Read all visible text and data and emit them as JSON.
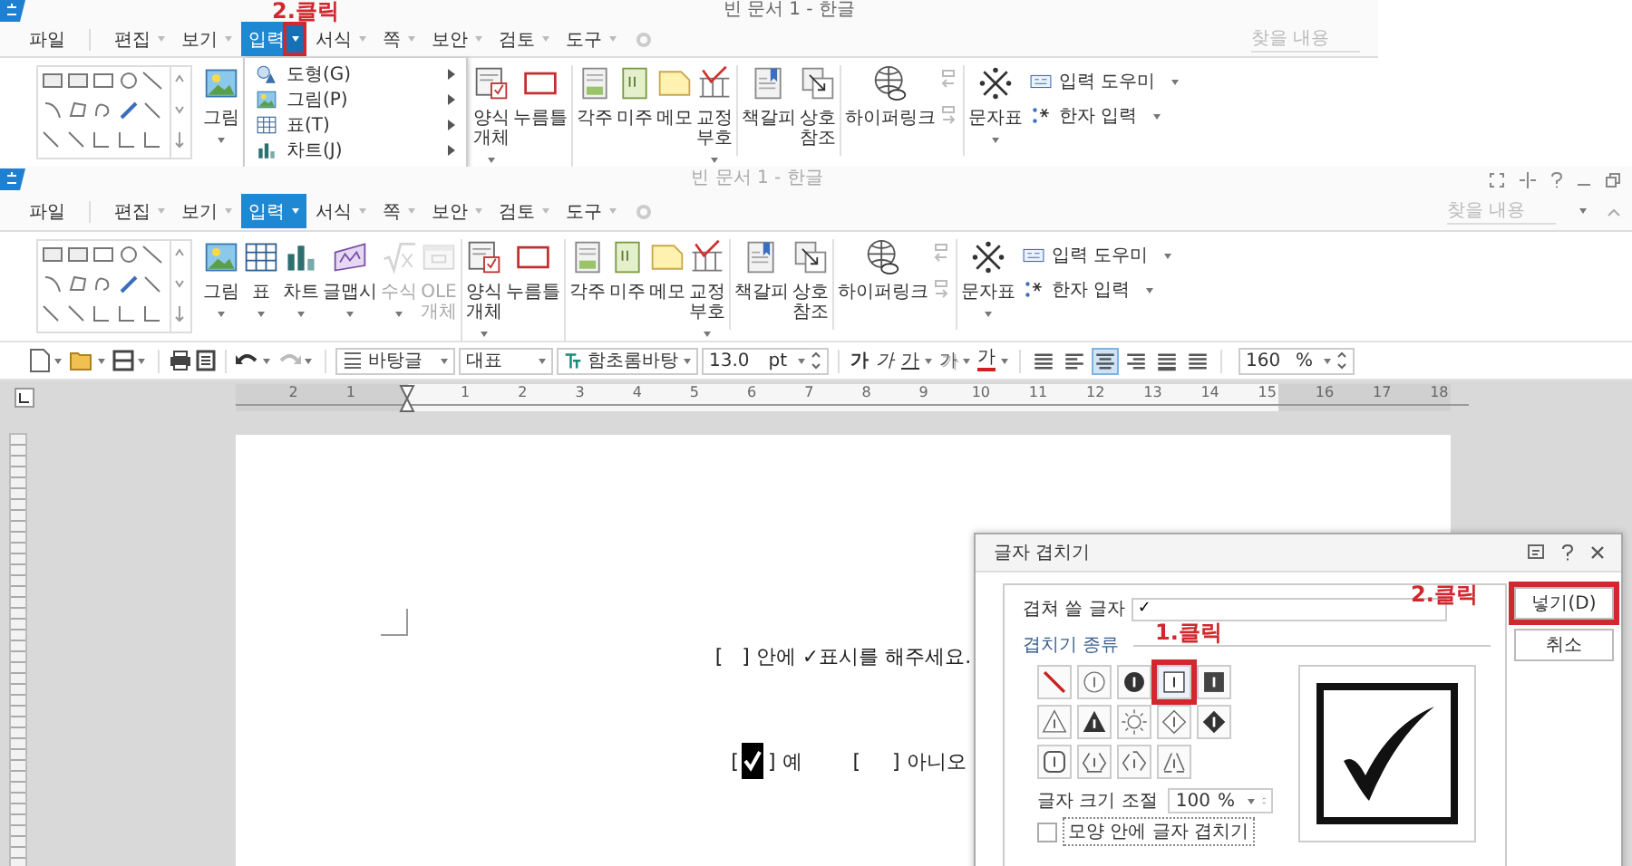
{
  "top": {
    "title": "빈 문서 1 - 한글",
    "annotation": "2.클릭",
    "file_menu": "파일",
    "menu": [
      {
        "label": "편집",
        "selected": false,
        "highlighted": false
      },
      {
        "label": "보기",
        "selected": false,
        "highlighted": false
      },
      {
        "label": "입력",
        "selected": true,
        "highlighted": true
      },
      {
        "label": "서식",
        "selected": false,
        "highlighted": false
      },
      {
        "label": "쪽",
        "selected": false,
        "highlighted": false
      },
      {
        "label": "보안",
        "selected": false,
        "highlighted": false
      },
      {
        "label": "검토",
        "selected": false,
        "highlighted": false
      },
      {
        "label": "도구",
        "selected": false,
        "highlighted": false
      }
    ],
    "search_placeholder": "찾을 내용",
    "groups": [
      [
        {
          "lines": [
            "그림"
          ],
          "kind": "picture",
          "dropdown": true,
          "disabled": false
        }
      ],
      [
        {
          "lines": [
            "양식",
            "개체"
          ],
          "kind": "form",
          "dropdown": true,
          "disabled": false
        },
        {
          "lines": [
            "누름틀"
          ],
          "kind": "field",
          "dropdown": false,
          "disabled": false
        }
      ],
      [
        {
          "lines": [
            "각주"
          ],
          "kind": "footnote",
          "dropdown": false,
          "disabled": false
        },
        {
          "lines": [
            "미주"
          ],
          "kind": "endnote",
          "dropdown": false,
          "disabled": false
        },
        {
          "lines": [
            "메모"
          ],
          "kind": "memo",
          "dropdown": false,
          "disabled": false
        },
        {
          "lines": [
            "교정",
            "부호"
          ],
          "kind": "proof",
          "dropdown": true,
          "disabled": false
        }
      ],
      [
        {
          "lines": [
            "책갈피"
          ],
          "kind": "bookmark",
          "dropdown": false,
          "disabled": false
        },
        {
          "lines": [
            "상호",
            "참조"
          ],
          "kind": "crossref",
          "dropdown": false,
          "disabled": false
        }
      ],
      [
        {
          "lines": [
            "하이퍼링크"
          ],
          "kind": "hyperlink",
          "dropdown": false,
          "disabled": false
        }
      ],
      [
        {
          "lines": [
            "문자표"
          ],
          "kind": "symbols",
          "dropdown": true,
          "disabled": false
        }
      ]
    ],
    "dropdown_menu": [
      {
        "label": "도형(G)",
        "kind": "shape"
      },
      {
        "label": "그림(P)",
        "kind": "picture"
      },
      {
        "label": "표(T)",
        "kind": "table"
      },
      {
        "label": "차트(J)",
        "kind": "chart"
      }
    ],
    "small_buttons": [
      {
        "label": "입력 도우미",
        "kind": "helper"
      },
      {
        "label": "한자 입력",
        "kind": "hanja"
      }
    ]
  },
  "main": {
    "title": "빈 문서 1 - 한글",
    "file_menu": "파일",
    "window_controls": true,
    "menu": [
      {
        "label": "편집",
        "selected": false,
        "highlighted": false
      },
      {
        "label": "보기",
        "selected": false,
        "highlighted": false
      },
      {
        "label": "입력",
        "selected": true,
        "highlighted": false
      },
      {
        "label": "서식",
        "selected": false,
        "highlighted": false
      },
      {
        "label": "쪽",
        "selected": false,
        "highlighted": false
      },
      {
        "label": "보안",
        "selected": false,
        "highlighted": false
      },
      {
        "label": "검토",
        "selected": false,
        "highlighted": false
      },
      {
        "label": "도구",
        "selected": false,
        "highlighted": false
      }
    ],
    "search_placeholder": "찾을 내용",
    "groups": [
      [
        {
          "lines": [
            "그림"
          ],
          "kind": "picture",
          "dropdown": true,
          "disabled": false
        },
        {
          "lines": [
            "표"
          ],
          "kind": "table",
          "dropdown": true,
          "disabled": false
        },
        {
          "lines": [
            "차트"
          ],
          "kind": "chart",
          "dropdown": true,
          "disabled": false
        },
        {
          "lines": [
            "글맵시"
          ],
          "kind": "textart",
          "dropdown": true,
          "disabled": false
        },
        {
          "lines": [
            "수식"
          ],
          "kind": "formula",
          "dropdown": true,
          "disabled": true
        },
        {
          "lines": [
            "OLE",
            "개체"
          ],
          "kind": "ole",
          "dropdown": false,
          "disabled": true
        }
      ],
      [
        {
          "lines": [
            "양식",
            "개체"
          ],
          "kind": "form",
          "dropdown": true,
          "disabled": false
        },
        {
          "lines": [
            "누름틀"
          ],
          "kind": "field",
          "dropdown": false,
          "disabled": false
        }
      ],
      [
        {
          "lines": [
            "각주"
          ],
          "kind": "footnote",
          "dropdown": false,
          "disabled": false
        },
        {
          "lines": [
            "미주"
          ],
          "kind": "endnote",
          "dropdown": false,
          "disabled": false
        },
        {
          "lines": [
            "메모"
          ],
          "kind": "memo",
          "dropdown": false,
          "disabled": false
        },
        {
          "lines": [
            "교정",
            "부호"
          ],
          "kind": "proof",
          "dropdown": true,
          "disabled": false
        }
      ],
      [
        {
          "lines": [
            "책갈피"
          ],
          "kind": "bookmark",
          "dropdown": false,
          "disabled": false
        },
        {
          "lines": [
            "상호",
            "참조"
          ],
          "kind": "crossref",
          "dropdown": false,
          "disabled": false
        }
      ],
      [
        {
          "lines": [
            "하이퍼링크"
          ],
          "kind": "hyperlink",
          "dropdown": false,
          "disabled": false
        }
      ],
      [
        {
          "lines": [
            "문자표"
          ],
          "kind": "symbols",
          "dropdown": true,
          "disabled": false
        }
      ]
    ],
    "small_buttons": [
      {
        "label": "입력 도우미",
        "kind": "helper"
      },
      {
        "label": "한자 입력",
        "kind": "hanja"
      }
    ]
  },
  "toolbar": {
    "style": "바탕글",
    "paragraph": "대표",
    "font": "함초롬바탕",
    "size": "13.0",
    "unit": "pt",
    "char_buttons": [
      {
        "label": "가",
        "kind": "bold",
        "dropdown": false
      },
      {
        "label": "가",
        "kind": "italic",
        "dropdown": false
      },
      {
        "label": "가",
        "kind": "underline",
        "dropdown": true
      },
      {
        "label": "가",
        "kind": "outline",
        "dropdown": true
      },
      {
        "label": "가",
        "kind": "color",
        "dropdown": true
      }
    ],
    "align": [
      {
        "kind": "justify",
        "selected": false
      },
      {
        "kind": "left",
        "selected": false
      },
      {
        "kind": "center",
        "selected": true
      },
      {
        "kind": "right",
        "selected": false
      },
      {
        "kind": "distribute",
        "selected": false
      },
      {
        "kind": "divide",
        "selected": false
      }
    ],
    "line_spacing": "160",
    "spacing_unit": "%"
  },
  "ruler": {
    "left_numbers": [
      "2",
      "1"
    ],
    "numbers": [
      "1",
      "2",
      "3",
      "4",
      "5",
      "6",
      "7",
      "8",
      "9",
      "10",
      "11",
      "12",
      "13",
      "14",
      "15",
      "16",
      "17",
      "18"
    ]
  },
  "document": {
    "instruction": "[   ] 안에 ✓표시를 해주세요.",
    "answer": {
      "open": "[",
      "checked": true,
      "yes": "] 예",
      "no": "[     ] 아니오"
    }
  },
  "dialog": {
    "title": "글자 겹치기",
    "text_label": "겹쳐 쓸 글자",
    "text_value": "✓",
    "type_label": "겹치기 종류",
    "annotation_select": "1.클릭",
    "annotation_insert": "2.클릭",
    "shapes": [
      {
        "kind": "slash",
        "selected": false
      },
      {
        "kind": "circle",
        "selected": false
      },
      {
        "kind": "filled-circle",
        "selected": false
      },
      {
        "kind": "square",
        "selected": true
      },
      {
        "kind": "filled-square",
        "selected": false
      },
      {
        "kind": "triangle",
        "selected": false
      },
      {
        "kind": "filled-triangle",
        "selected": false
      },
      {
        "kind": "sun",
        "selected": false
      },
      {
        "kind": "diamond",
        "selected": false
      },
      {
        "kind": "filled-diamond",
        "selected": false
      },
      {
        "kind": "rounded-square",
        "selected": false
      },
      {
        "kind": "recycle",
        "selected": false
      },
      {
        "kind": "recycle-open",
        "selected": false
      },
      {
        "kind": "recycle-split",
        "selected": false
      }
    ],
    "size_label": "글자 크기 조절",
    "size_value": "100",
    "size_unit": "%",
    "inside_label": "모양 안에 글자 겹치기",
    "inside_checked": false,
    "buttons": [
      {
        "label": "넣기(D)",
        "highlighted": true
      },
      {
        "label": "취소",
        "highlighted": false
      }
    ]
  }
}
